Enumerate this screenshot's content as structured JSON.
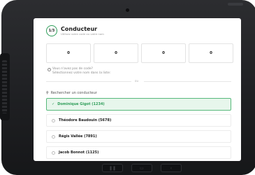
{
  "header": {
    "step": "1/3",
    "title": "Conducteur",
    "subtitle": "Utilisez votre code ou votre nom"
  },
  "code_boxes": [
    "0",
    "0",
    "0",
    "0"
  ],
  "hint": {
    "line1": "Vous n'avez pas de code?",
    "line2": "Sélectionnez votre nom dans la liste:"
  },
  "divider": {
    "text": "ou"
  },
  "search": {
    "placeholder": "Rechercher un conducteur"
  },
  "drivers": [
    {
      "name": "Dominique Gigot (1234)",
      "selected": true
    },
    {
      "name": "Théodore Baudouin (5678)",
      "selected": false
    },
    {
      "name": "Régis Vallée (7891)",
      "selected": false
    },
    {
      "name": "Jacob Bonnot (1125)",
      "selected": false
    }
  ],
  "colors": {
    "accent": "#2f9e5a",
    "selected_bg": "#e7f6ec",
    "device_frame": "#1f2023"
  },
  "icons": {
    "search": "search-icon",
    "check": "check-icon",
    "help": "question-icon"
  }
}
